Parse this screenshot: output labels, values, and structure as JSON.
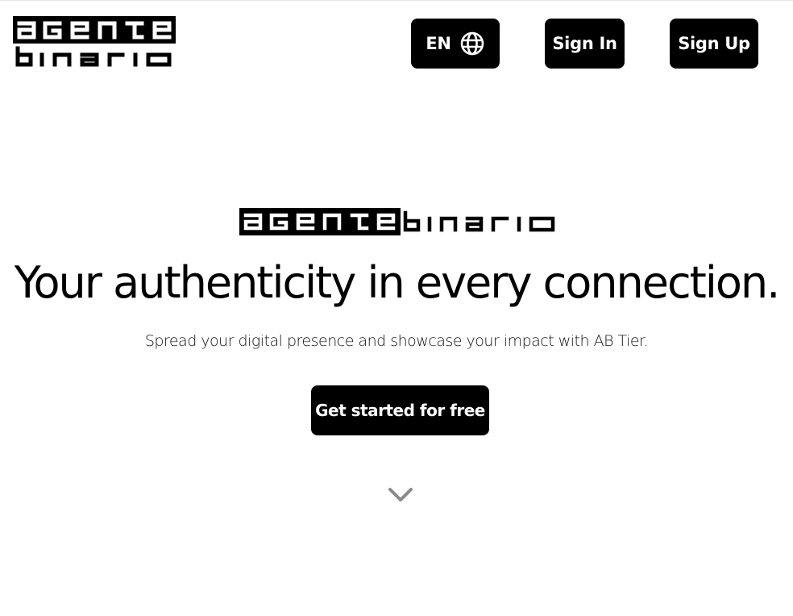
{
  "header": {
    "logo_alt": "agente binario",
    "language_label": "EN",
    "sign_in_label": "Sign In",
    "sign_up_label": "Sign Up"
  },
  "hero": {
    "logo_alt": "agente binario",
    "headline": "Your authenticity in every connection.",
    "subheadline": "Spread your digital presence and showcase your impact with AB Tier.",
    "cta_label": "Get started for free"
  },
  "icons": {
    "language": "globe-icon",
    "scroll": "chevron-down-icon"
  },
  "colors": {
    "background": "#ffffff",
    "button": "#000000",
    "button_text": "#ffffff",
    "chevron": "#8a8a8a"
  }
}
